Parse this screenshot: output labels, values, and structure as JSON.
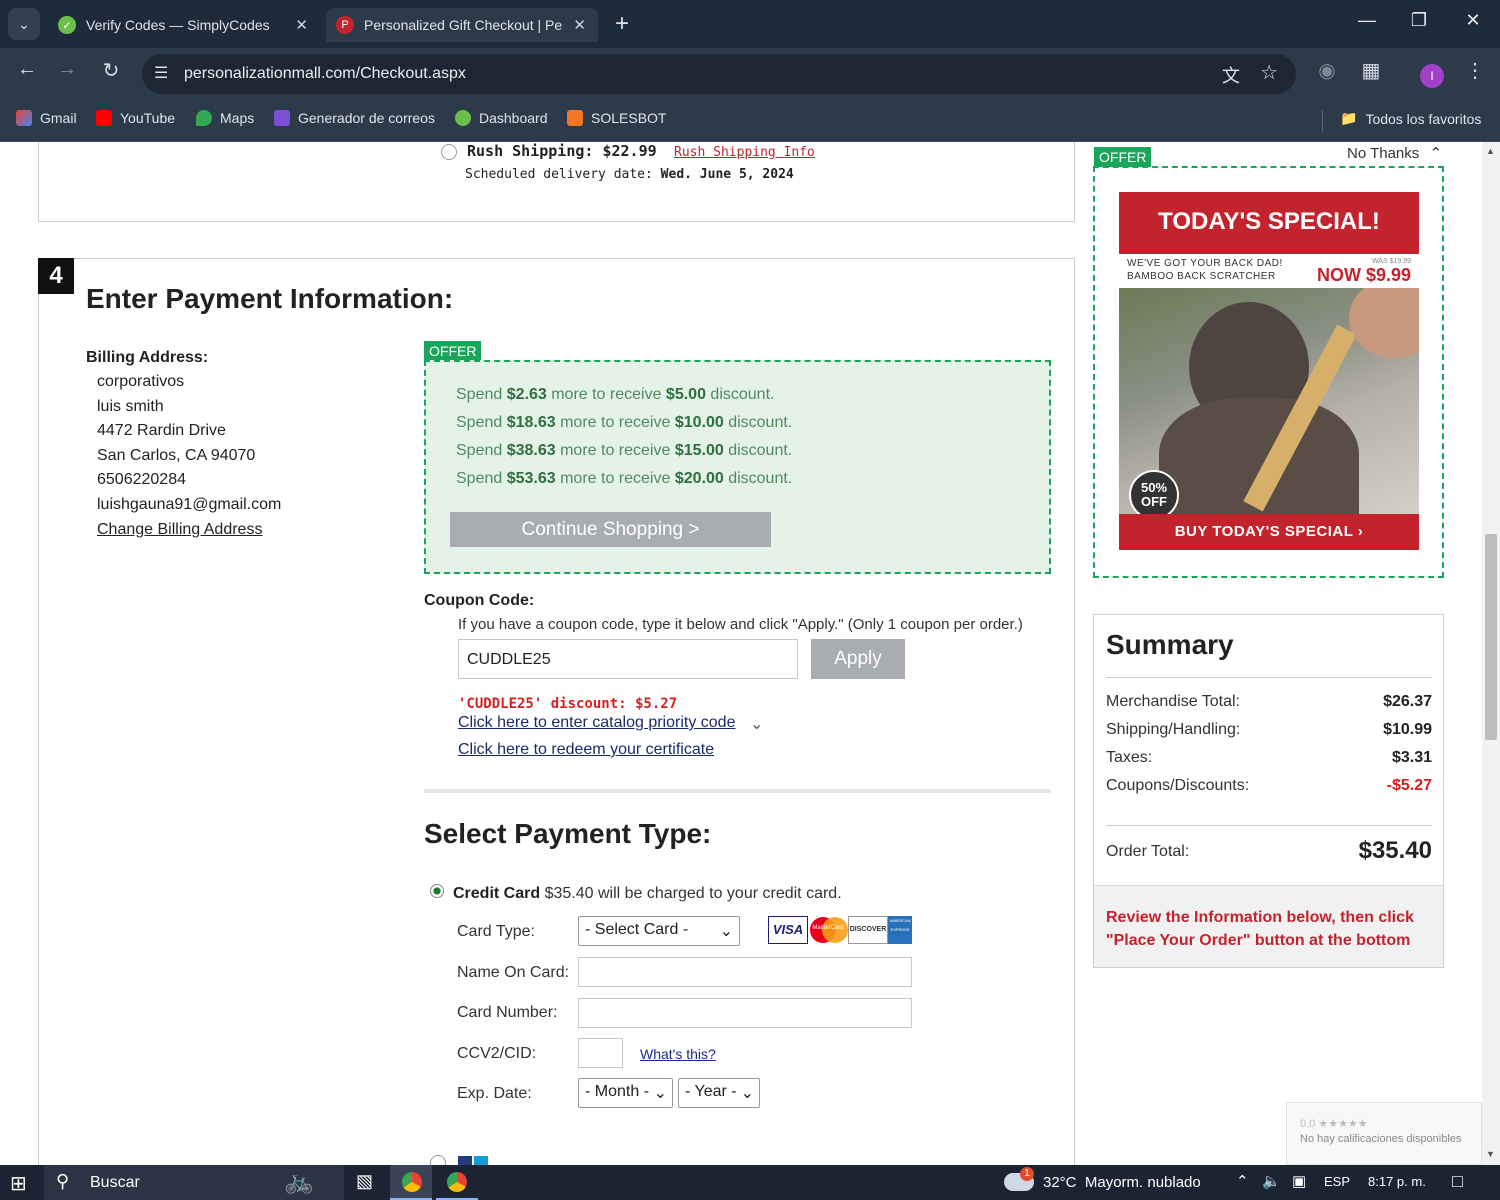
{
  "browser": {
    "tabs": [
      {
        "title": "Verify Codes — SimplyCodes",
        "active": false
      },
      {
        "title": "Personalized Gift Checkout | Pe",
        "active": true
      }
    ],
    "url": "personalizationmall.com/Checkout.aspx",
    "bookmarks": [
      "Gmail",
      "YouTube",
      "Maps",
      "Generador de correos",
      "Dashboard",
      "SOLESBOT"
    ],
    "all_bookmarks": "Todos los favoritos",
    "profile_initial": "I"
  },
  "shipping": {
    "rush_label": "Rush Shipping: $22.99",
    "rush_info_link": "Rush Shipping Info",
    "scheduled_label": "Scheduled delivery date:",
    "scheduled_date": "Wed. June 5, 2024"
  },
  "payment": {
    "step_number": "4",
    "heading": "Enter Payment Information:",
    "billing_title": "Billing Address:",
    "billing_lines": [
      "corporativos",
      "luis smith",
      "4472 Rardin Drive",
      "San Carlos, CA 94070",
      "6506220284",
      "luishgauna91@gmail.com"
    ],
    "change_billing": "Change Billing Address"
  },
  "offer": {
    "label": "OFFER",
    "lines": [
      {
        "a": "Spend ",
        "amount": "$2.63",
        "b": " more to receive ",
        "discount": "$5.00",
        "c": " discount."
      },
      {
        "a": "Spend ",
        "amount": "$18.63",
        "b": " more to receive ",
        "discount": "$10.00",
        "c": " discount."
      },
      {
        "a": "Spend ",
        "amount": "$38.63",
        "b": " more to receive ",
        "discount": "$15.00",
        "c": " discount."
      },
      {
        "a": "Spend ",
        "amount": "$53.63",
        "b": " more to receive ",
        "discount": "$20.00",
        "c": " discount."
      }
    ],
    "continue_button": "Continue Shopping >"
  },
  "coupon": {
    "title": "Coupon Code:",
    "instructions": "If you have a coupon code, type it below and click \"Apply.\" (Only 1 coupon per order.)",
    "value": "CUDDLE25",
    "apply_button": "Apply",
    "applied_msg": "'CUDDLE25' discount: $5.27",
    "catalog_link": "Click here to enter catalog priority code",
    "certificate_link": "Click here to redeem your certificate"
  },
  "payment_type": {
    "heading": "Select Payment Type:",
    "credit_card_label": "Credit Card",
    "credit_card_text": "$35.40 will be charged to your credit card.",
    "card_type_label": "Card Type:",
    "card_type_value": "- Select Card -",
    "name_label": "Name On Card:",
    "number_label": "Card Number:",
    "ccv_label": "CCV2/CID:",
    "whats_this": "What's this?",
    "exp_label": "Exp. Date:",
    "month_value": "- Month -",
    "year_value": "- Year -",
    "card_logos": [
      "VISA",
      "MasterCard",
      "DISCOVER",
      "AMERICAN EXPRESS"
    ]
  },
  "side_offer": {
    "label": "OFFER",
    "no_thanks": "No Thanks",
    "banner_title": "TODAY'S SPECIAL!",
    "line1": "WE'VE GOT YOUR BACK DAD!",
    "line2": "BAMBOO BACK SCRATCHER",
    "was": "WAS $19.99",
    "now": "NOW $9.99",
    "badge": "50% OFF",
    "buy_button": "BUY TODAY'S SPECIAL ›"
  },
  "summary": {
    "title": "Summary",
    "rows": [
      {
        "label": "Merchandise Total:",
        "value": "$26.37"
      },
      {
        "label": "Shipping/Handling:",
        "value": "$10.99"
      },
      {
        "label": "Taxes:",
        "value": "$3.31"
      },
      {
        "label": "Coupons/Discounts:",
        "value": "-$5.27"
      }
    ],
    "order_total_label": "Order Total:",
    "order_total_value": "$35.40",
    "review_note": "Review the Information below, then click \"Place Your Order\" button at the bottom"
  },
  "rating_widget": {
    "score": "0.0 ★★★★★",
    "text": "No hay calificaciones disponibles"
  },
  "taskbar": {
    "search": "Buscar",
    "weather": "32°C  Mayorm. nublado",
    "lang": "ESP",
    "time": "8:17 p. m.",
    "weather_badge": "1"
  },
  "colors": {
    "accent_green": "#1aa65a",
    "brand_red": "#c3232c",
    "discount_red": "#d81e1e"
  }
}
